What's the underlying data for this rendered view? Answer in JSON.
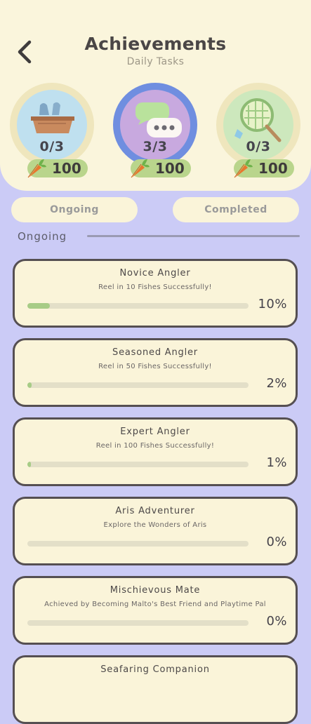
{
  "header": {
    "title": "Achievements",
    "subtitle": "Daily Tasks"
  },
  "daily_tasks": [
    {
      "icon": "fish-basket-icon",
      "count": "0/3",
      "reward": "100",
      "disc_color": "#bfe0ef"
    },
    {
      "icon": "chat-bubbles-icon",
      "count": "3/3",
      "reward": "100",
      "disc_color": "#c8a9df"
    },
    {
      "icon": "butterfly-net-icon",
      "count": "0/3",
      "reward": "100",
      "disc_color": "#cde8bd"
    }
  ],
  "tabs": {
    "ongoing": "Ongoing",
    "completed": "Completed"
  },
  "section": {
    "label": "Ongoing"
  },
  "achievements": [
    {
      "title": "Novice Angler",
      "description": "Reel in 10 Fishes Successfully!",
      "percent_label": "10%",
      "progress": 0.1
    },
    {
      "title": "Seasoned Angler",
      "description": "Reel in 50 Fishes Successfully!",
      "percent_label": "2%",
      "progress": 0.02
    },
    {
      "title": "Expert Angler",
      "description": "Reel in 100 Fishes Successfully!",
      "percent_label": "1%",
      "progress": 0.01
    },
    {
      "title": "Aris Adventurer",
      "description": "Explore the Wonders of Aris",
      "percent_label": "0%",
      "progress": 0
    },
    {
      "title": "Mischievous Mate",
      "description": "Achieved by Becoming Malto's Best Friend and Playtime Pal",
      "percent_label": "0%",
      "progress": 0
    },
    {
      "title": "Seafaring Companion",
      "description": "",
      "percent_label": "",
      "progress": 0
    }
  ],
  "colors": {
    "background": "#cbcbf6",
    "panel": "#faf4d9",
    "progress_fill": "#a7cc86",
    "reward_pill": "#b9d58c",
    "highlight_ring": "#6f8ee0"
  }
}
